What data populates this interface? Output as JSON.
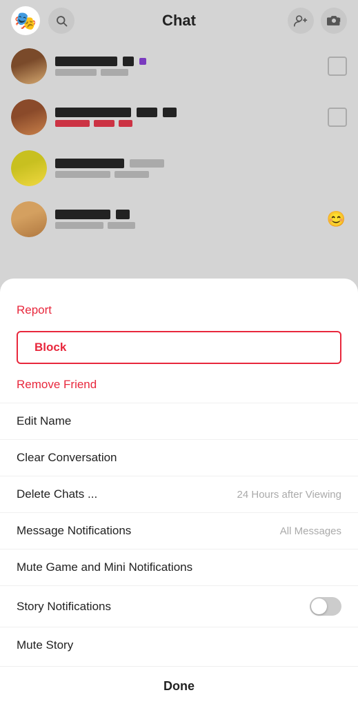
{
  "header": {
    "title": "Chat",
    "search_label": "search",
    "add_friend_label": "add friend",
    "camera_label": "camera"
  },
  "chat_items": [
    {
      "id": 1,
      "avatar_class": "av1",
      "has_icon": true,
      "emoji": ""
    },
    {
      "id": 2,
      "avatar_class": "av2",
      "has_icon": true,
      "emoji": ""
    },
    {
      "id": 3,
      "avatar_class": "av3",
      "has_icon": false,
      "emoji": ""
    },
    {
      "id": 4,
      "avatar_class": "av4",
      "has_icon": false,
      "emoji": "😊"
    }
  ],
  "menu": {
    "report_label": "Report",
    "block_label": "Block",
    "remove_friend_label": "Remove Friend",
    "edit_name_label": "Edit Name",
    "clear_conversation_label": "Clear Conversation",
    "delete_chats_label": "Delete Chats ...",
    "delete_chats_value": "24 Hours after Viewing",
    "message_notifications_label": "Message Notifications",
    "message_notifications_value": "All Messages",
    "mute_game_label": "Mute Game and Mini Notifications",
    "story_notifications_label": "Story Notifications",
    "mute_story_label": "Mute Story",
    "done_label": "Done"
  }
}
